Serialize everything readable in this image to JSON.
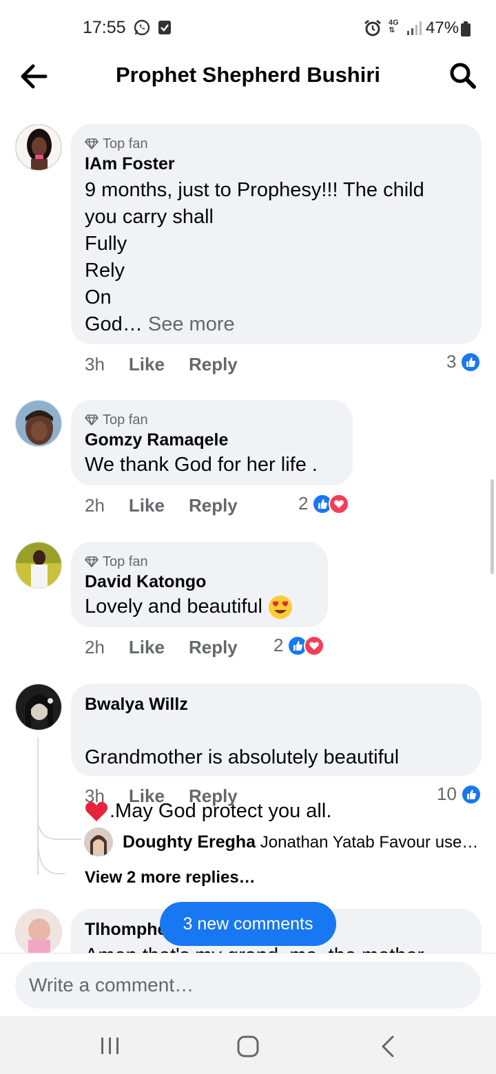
{
  "status_bar": {
    "time": "17:55",
    "network": "4G",
    "battery": "47%"
  },
  "header": {
    "title": "Prophet Shepherd Bushiri"
  },
  "comments": [
    {
      "badge": "Top fan",
      "author": "IAm Foster",
      "text": "9 months, just to Prophesy!!! The child\nyou carry shall\nFully\nRely\nOn\nGod…",
      "see_more": "See more",
      "time": "3h",
      "like": "Like",
      "reply": "Reply",
      "reaction_count": "3"
    },
    {
      "badge": "Top fan",
      "author": "Gomzy Ramaqele",
      "text": "We thank God for her life .",
      "time": "2h",
      "like": "Like",
      "reply": "Reply",
      "reaction_count": "2"
    },
    {
      "badge": "Top fan",
      "author": "David Katongo",
      "text": "Lovely and beautiful",
      "time": "2h",
      "like": "Like",
      "reply": "Reply",
      "reaction_count": "2"
    },
    {
      "author": "Bwalya Willz",
      "text_line1": "Grandmother is absolutely beautiful",
      "text_line2": ".May God protect you all.",
      "time": "3h",
      "like": "Like",
      "reply": "Reply",
      "reaction_count": "10",
      "reply_preview": {
        "author": "Doughty Eregha",
        "text": "Jonathan Yatab Favour use…"
      },
      "view_more": "View 2 more replies…"
    },
    {
      "author": "Tlhomphe",
      "text": "Amen that's my grand, ma, the mother"
    }
  ],
  "new_comments_pill": "3 new comments",
  "composer": {
    "placeholder": "Write a comment…"
  },
  "colors": {
    "accent": "#1877f2",
    "love": "#f33e58",
    "bubble": "#f0f2f5",
    "muted": "#65676b"
  }
}
